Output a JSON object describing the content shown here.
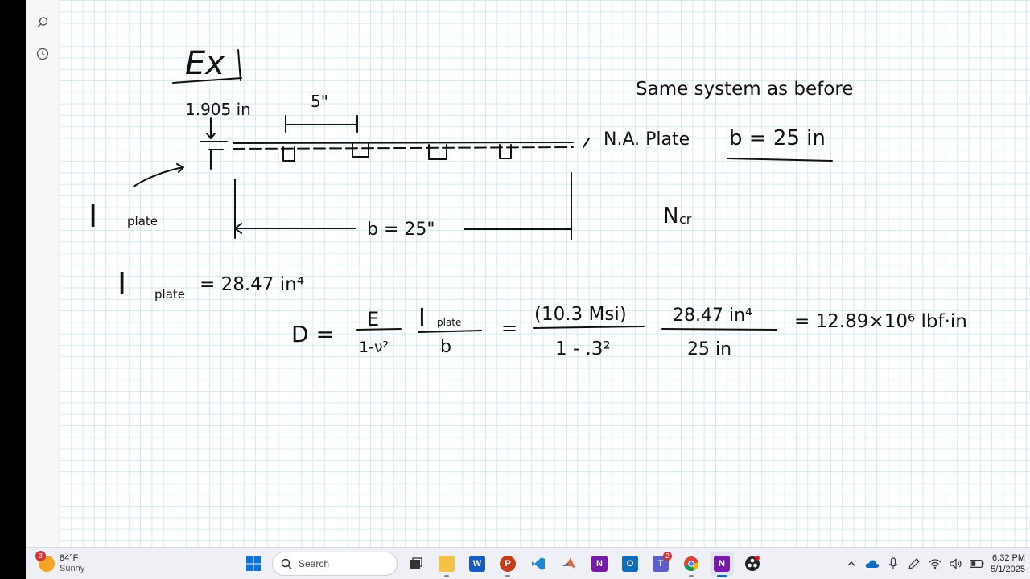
{
  "notebook": {
    "title_text": "Ex",
    "left_dim": "1.905 in",
    "spacing_dim": "5\"",
    "plate_label": "I",
    "plate_sub": "plate",
    "width_label": "b = 25\"",
    "right_line1": "Same system as before",
    "right_line2": "N.A. Plate",
    "right_line2b": "b = 25 in",
    "ncr_label": "N",
    "ncr_sub": "cr",
    "eq1_lhs": "I",
    "eq1_sub": "plate",
    "eq1_rhs": "= 28.47 in⁴",
    "eq2_D": "D =",
    "eq2_frac1_num": "E",
    "eq2_frac1_den": "1-ν²",
    "eq2_frac2_num": "I",
    "eq2_frac2_num_sub": "plate",
    "eq2_frac2_den": "b",
    "eq2_eq": "=",
    "eq2_frac3_num": "(10.3 Msi)",
    "eq2_frac3_den": "1 - .3²",
    "eq2_frac4_num": "28.47 in⁴",
    "eq2_frac4_den": "25 in",
    "eq2_result": "= 12.89×10⁶ lbf·in"
  },
  "rail": {
    "icons": [
      "search-icon",
      "clock-icon"
    ]
  },
  "taskbar": {
    "weather_temp": "84°F",
    "weather_desc": "Sunny",
    "weather_badge": "3",
    "search_placeholder": "Search",
    "teams_badge": "2",
    "time": "6:32 PM",
    "date": "5/1/2025",
    "apps": [
      "start",
      "search",
      "task-view",
      "file-explorer",
      "word",
      "powerpoint",
      "vscode",
      "matlab",
      "onenote-alt",
      "outlook",
      "teams",
      "chrome",
      "onenote",
      "obs"
    ]
  },
  "colors": {
    "grid": "#d5eaf2",
    "ink": "#111111",
    "taskbar": "#eef0f5",
    "accent": "#0067c0"
  }
}
